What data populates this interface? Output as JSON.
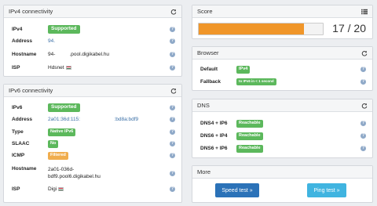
{
  "ipv4": {
    "title": "IPv4 connectivity",
    "ipv4_label": "IPv4",
    "ipv4_badge": "Supported",
    "address_label": "Address",
    "address_value": "94.",
    "hostname_label": "Hostname",
    "hostname_value": "94-          .pool.digikabel.hu",
    "isp_label": "ISP",
    "isp_value": "Hdsnet"
  },
  "ipv6": {
    "title": "IPv6 connectivity",
    "ipv6_label": "IPv6",
    "ipv6_badge": "Supported",
    "address_label": "Address",
    "address_value": "2a01:36d:115:                        :bd8a:bdf9",
    "type_label": "Type",
    "type_badge": "Native IPv6",
    "slaac_label": "SLAAC",
    "slaac_badge": "No",
    "icmp_label": "ICMP",
    "icmp_badge": "Filtered",
    "hostname_label": "Hostname",
    "hostname_value_1": "2a01-036d-",
    "hostname_value_2": "bdf9.pool6.digikabel.hu",
    "isp_label": "ISP",
    "isp_value": "Digi"
  },
  "score": {
    "title": "Score",
    "text": "17 / 20",
    "fraction": 0.85,
    "bar_color": "#f0962a"
  },
  "browser": {
    "title": "Browser",
    "default_label": "Default",
    "default_badge": "IPv4",
    "fallback_label": "Fallback",
    "fallback_badge": "to IPv6 in < 1 second"
  },
  "dns": {
    "title": "DNS",
    "rows": [
      {
        "label": "DNS4 + IP6",
        "badge": "Reachable"
      },
      {
        "label": "DNS6 + IP4",
        "badge": "Reachable"
      },
      {
        "label": "DNS6 + IP6",
        "badge": "Reachable"
      }
    ]
  },
  "more": {
    "title": "More",
    "speed_label": "Speed test »",
    "ping_label": "Ping test »"
  },
  "colors": {
    "green": "#5cb85c",
    "orange": "#f0ad4e",
    "speed_btn": "#2b72b8",
    "ping_btn": "#40b4e0"
  }
}
